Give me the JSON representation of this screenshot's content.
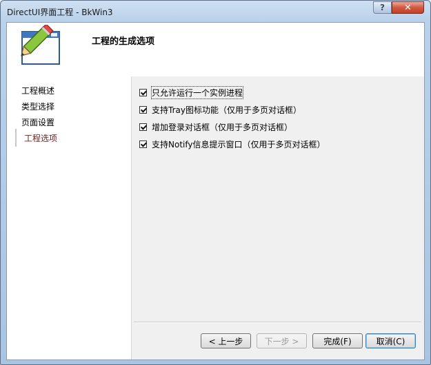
{
  "window": {
    "title": "DirectUI界面工程 - BkWin3",
    "help_label": "?",
    "close_label": "✕"
  },
  "header": {
    "title": "工程的生成选项",
    "icon": "pencil-window-icon"
  },
  "nav": {
    "items": [
      {
        "label": "工程概述"
      },
      {
        "label": "类型选择"
      },
      {
        "label": "页面设置"
      },
      {
        "label": "工程选项"
      }
    ],
    "active_index": 3
  },
  "options": [
    {
      "label": "只允许运行一个实例进程",
      "checked": true
    },
    {
      "label": "支持Tray图标功能（仅用于多页对话框）",
      "checked": true
    },
    {
      "label": "增加登录对话框（仅用于多页对话框）",
      "checked": true
    },
    {
      "label": "支持Notify信息提示窗口（仅用于多页对话框）",
      "checked": true
    }
  ],
  "buttons": {
    "prev": "< 上一步",
    "next": "下一步 >",
    "finish": "完成(F)",
    "cancel": "取消(C)"
  },
  "colors": {
    "active_nav": "#6b1f1f",
    "close_button": "#c24128"
  }
}
